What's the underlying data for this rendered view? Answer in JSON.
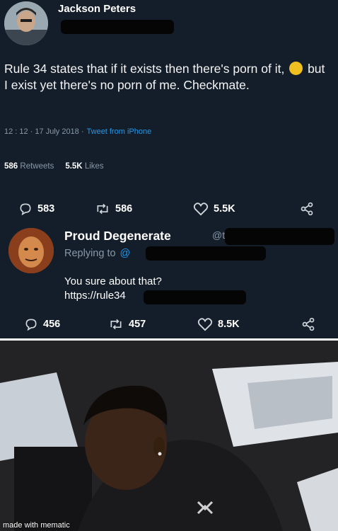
{
  "tweet": {
    "author_name": "Jackson Peters",
    "text_part1": "Rule 34 states that if it exists then there's porn of it,",
    "text_part2": "but I exist yet there's no porn of me. Checkmate.",
    "emoji": "thinking-face-emoji",
    "timestamp": "12 : 12 · 17 July 2018 ·",
    "source": "Tweet from iPhone",
    "retweets_count": "586",
    "retweets_label": "Retweets",
    "likes_count": "5.5K",
    "likes_label": "Likes",
    "actions": {
      "replies": "583",
      "retweets": "586",
      "likes": "5.5K"
    }
  },
  "reply": {
    "author_name": "Proud Degenerate",
    "handle": "@t",
    "replying_to_label": "Replying to",
    "replying_to_handle": "@",
    "line1": "You sure about that?",
    "line2": "https://rule34",
    "actions": {
      "replies": "456",
      "retweets": "457",
      "likes": "8.5K"
    }
  },
  "image": {
    "watermark": "made with mematic"
  },
  "colors": {
    "background": "#141d2a",
    "secondary_text": "#8899a6",
    "accent": "#1d9bf0"
  }
}
